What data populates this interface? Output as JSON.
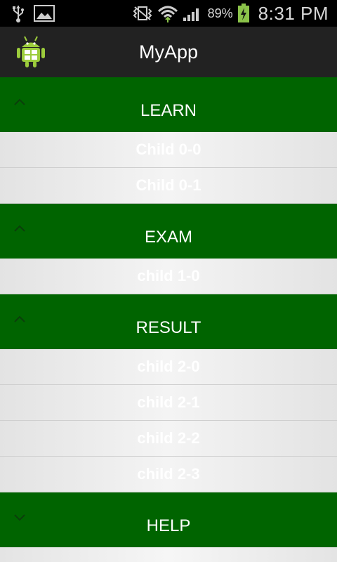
{
  "status_bar": {
    "battery_percent": "89%",
    "time": "8:31 PM",
    "icons": [
      "usb-icon",
      "image-icon",
      "vibrate-icon",
      "wifi-icon",
      "signal-icon",
      "battery-charging-icon"
    ]
  },
  "action_bar": {
    "title": "MyApp",
    "icon": "android-icon"
  },
  "groups": [
    {
      "label": "LEARN",
      "expanded": true,
      "children": [
        "Child 0-0",
        "Child 0-1"
      ]
    },
    {
      "label": "EXAM",
      "expanded": true,
      "children": [
        "child 1-0"
      ]
    },
    {
      "label": "RESULT",
      "expanded": true,
      "children": [
        "child 2-0",
        "child 2-1",
        "child 2-2",
        "child 2-3"
      ]
    },
    {
      "label": "HELP",
      "expanded": false,
      "children": []
    }
  ],
  "colors": {
    "group_background": "#006400",
    "action_bar": "#222222",
    "status_bar": "#000000",
    "battery_accent": "#8bc34a"
  }
}
